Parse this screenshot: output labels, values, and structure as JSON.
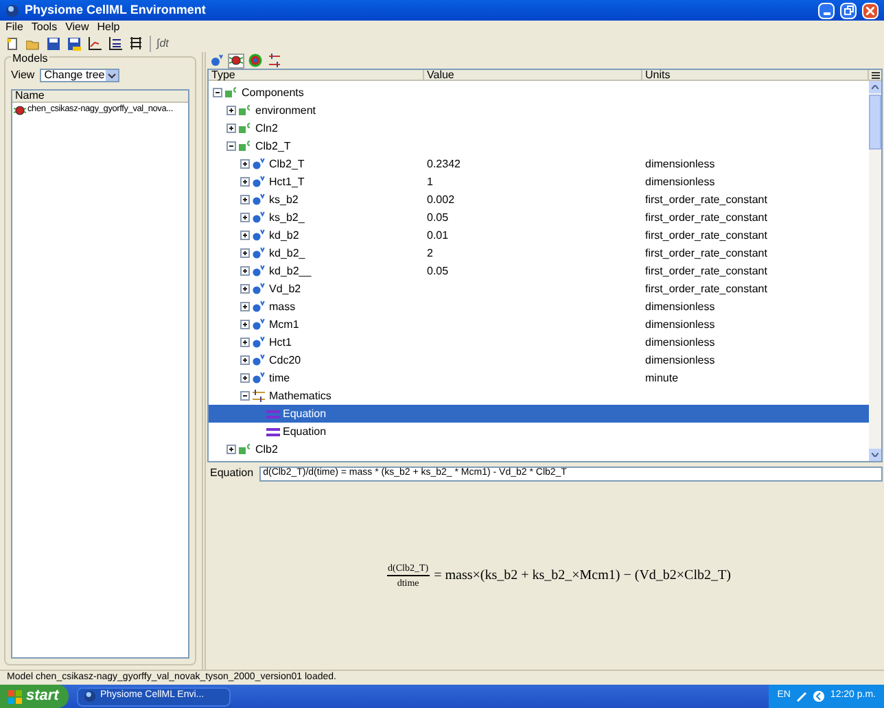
{
  "window": {
    "title": "Physiome CellML Environment"
  },
  "menu": [
    "File",
    "Tools",
    "View",
    "Help"
  ],
  "toolbar": [
    {
      "kind": "new"
    },
    {
      "kind": "open"
    },
    {
      "kind": "save"
    },
    {
      "kind": "saveas"
    },
    {
      "kind": "graph"
    },
    {
      "kind": "graph2"
    },
    {
      "kind": "table"
    },
    {
      "kind": "text",
      "label": "∫dt"
    }
  ],
  "models": {
    "title": "Models",
    "view_label": "View",
    "view_value": "Change tree",
    "column": "Name",
    "items": [
      {
        "label": "chen_csikasz-nagy_gyorffy_val_nova...",
        "selected": false
      }
    ]
  },
  "view_tabs": [
    {
      "kind": "variable",
      "selected": false
    },
    {
      "kind": "bug",
      "selected": true
    },
    {
      "kind": "ball",
      "selected": false
    },
    {
      "kind": "math",
      "selected": false
    }
  ],
  "tree": {
    "columns": [
      "Type",
      "Value",
      "Units"
    ],
    "nodes": [
      {
        "kind": "component",
        "label": "Components",
        "expanded": true,
        "children": [
          {
            "kind": "component",
            "label": "environment",
            "expanded": false
          },
          {
            "kind": "component",
            "label": "Cln2",
            "expanded": false
          },
          {
            "kind": "component",
            "label": "Clb2_T",
            "expanded": true,
            "children": [
              {
                "kind": "variable",
                "label": "Clb2_T",
                "value": "0.2342",
                "units": "dimensionless",
                "expanded": false
              },
              {
                "kind": "variable",
                "label": "Hct1_T",
                "value": "1",
                "units": "dimensionless",
                "expanded": false
              },
              {
                "kind": "variable",
                "label": "ks_b2",
                "value": "0.002",
                "units": "first_order_rate_constant",
                "expanded": false
              },
              {
                "kind": "variable",
                "label": "ks_b2_",
                "value": "0.05",
                "units": "first_order_rate_constant",
                "expanded": false
              },
              {
                "kind": "variable",
                "label": "kd_b2",
                "value": "0.01",
                "units": "first_order_rate_constant",
                "expanded": false
              },
              {
                "kind": "variable",
                "label": "kd_b2_",
                "value": "2",
                "units": "first_order_rate_constant",
                "expanded": false
              },
              {
                "kind": "variable",
                "label": "kd_b2__",
                "value": "0.05",
                "units": "first_order_rate_constant",
                "expanded": false
              },
              {
                "kind": "variable",
                "label": "Vd_b2",
                "units": "first_order_rate_constant",
                "expanded": false
              },
              {
                "kind": "variable",
                "label": "mass",
                "units": "dimensionless",
                "expanded": false
              },
              {
                "kind": "variable",
                "label": "Mcm1",
                "units": "dimensionless",
                "expanded": false
              },
              {
                "kind": "variable",
                "label": "Hct1",
                "units": "dimensionless",
                "expanded": false
              },
              {
                "kind": "variable",
                "label": "Cdc20",
                "units": "dimensionless",
                "expanded": false
              },
              {
                "kind": "variable",
                "label": "time",
                "units": "minute",
                "expanded": false
              },
              {
                "kind": "math",
                "label": "Mathematics",
                "expanded": true,
                "children": [
                  {
                    "kind": "equation",
                    "label": "Equation",
                    "selected": true
                  },
                  {
                    "kind": "equation",
                    "label": "Equation",
                    "selected": false
                  }
                ]
              }
            ]
          },
          {
            "kind": "component",
            "label": "Clb2",
            "expanded": false
          }
        ]
      }
    ]
  },
  "equation": {
    "label": "Equation",
    "value": "d(Clb2_T)/d(time) = mass * (ks_b2 + ks_b2_ * Mcm1) - Vd_b2 * Clb2_T",
    "numerator": "d(Clb2_T)",
    "denominator": "dtime",
    "rhs": "= mass×(ks_b2 + ks_b2_×Mcm1) − (Vd_b2×Clb2_T)"
  },
  "status_bar": "Model chen_csikasz-nagy_gyorffy_val_novak_tyson_2000_version01 loaded.",
  "taskbar": {
    "start": "start",
    "tasks": [
      "Physiome CellML Envi..."
    ],
    "language": "EN",
    "clock": "12:20 p.m."
  }
}
